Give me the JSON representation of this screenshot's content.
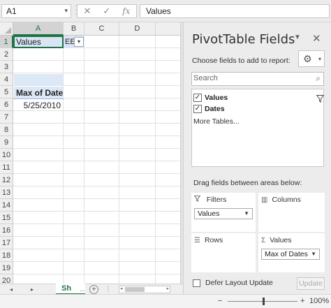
{
  "formula_bar": {
    "name_box": "A1",
    "cancel_icon": "✕",
    "enter_icon": "✓",
    "fx_icon": "fx",
    "formula": "Values"
  },
  "grid": {
    "columns": [
      "A",
      "B",
      "C",
      "D"
    ],
    "rows": [
      "1",
      "2",
      "3",
      "4",
      "5",
      "6",
      "7",
      "8",
      "9",
      "10",
      "11",
      "12",
      "13",
      "14",
      "15",
      "16",
      "17",
      "18",
      "19",
      "20"
    ],
    "cells": {
      "A1": "Values",
      "B1": "EE",
      "A4": "Max of Dates",
      "A5": "5/25/2010"
    }
  },
  "sheet_tabs": {
    "active_tab": "Sh",
    "more": "...",
    "add_label": "+",
    "prev": "◂",
    "next": "▸"
  },
  "status_bar": {
    "zoom_minus": "−",
    "zoom_plus": "+",
    "zoom_level": "100%"
  },
  "pivot_panel": {
    "title": "PivotTable Fields",
    "choose_label": "Choose fields to add to report:",
    "search_placeholder": "Search",
    "fields": [
      {
        "label": "Values",
        "checked": "✓"
      },
      {
        "label": "Dates",
        "checked": "✓"
      }
    ],
    "more_tables": "More Tables...",
    "drag_label": "Drag fields between areas below:",
    "areas": {
      "filters": {
        "label": "Filters",
        "item": "Values"
      },
      "columns": {
        "label": "Columns"
      },
      "rows": {
        "label": "Rows"
      },
      "values": {
        "label": "Values",
        "item": "Max of Dates"
      }
    },
    "defer_label": "Defer Layout Update",
    "update_label": "Update"
  },
  "icons": {
    "gear": "gear-icon",
    "close": "close-icon",
    "filter": "filter-icon",
    "search": "search-icon"
  },
  "colors": {
    "accent": "#217346",
    "selection_fill": "#d9e5f4",
    "panel_bg": "#ececec"
  }
}
